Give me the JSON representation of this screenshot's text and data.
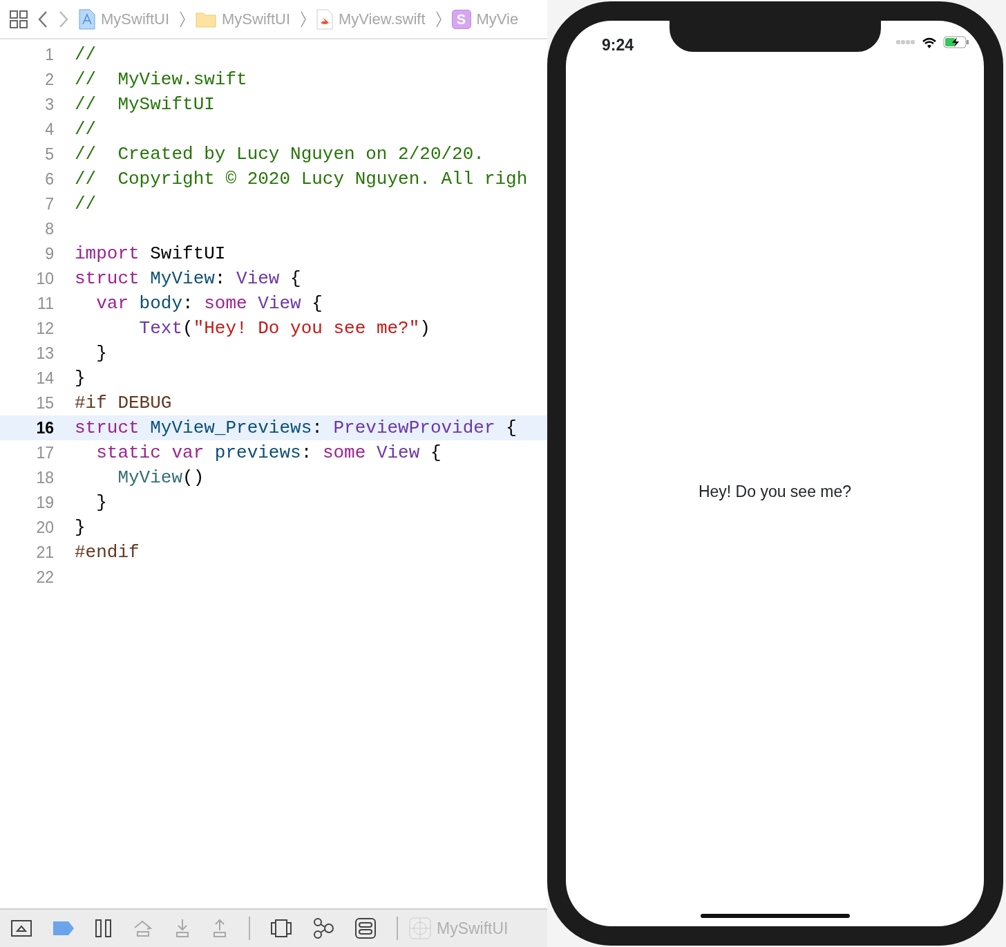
{
  "breadcrumb": [
    {
      "label": "MySwiftUI",
      "kind": "project"
    },
    {
      "label": "MySwiftUI",
      "kind": "folder"
    },
    {
      "label": "MyView.swift",
      "kind": "swift"
    },
    {
      "label": "MyVie",
      "kind": "struct",
      "badge": "S"
    }
  ],
  "code_lines": [
    {
      "number": "1",
      "current": false,
      "tokens": [
        {
          "text": "//",
          "kind": "comment"
        }
      ]
    },
    {
      "number": "2",
      "current": false,
      "tokens": [
        {
          "text": "//  MyView.swift",
          "kind": "comment"
        }
      ]
    },
    {
      "number": "3",
      "current": false,
      "tokens": [
        {
          "text": "//  MySwiftUI",
          "kind": "comment"
        }
      ]
    },
    {
      "number": "4",
      "current": false,
      "tokens": [
        {
          "text": "//",
          "kind": "comment"
        }
      ]
    },
    {
      "number": "5",
      "current": false,
      "tokens": [
        {
          "text": "//  Created by Lucy Nguyen on 2/20/20.",
          "kind": "comment"
        }
      ]
    },
    {
      "number": "6",
      "current": false,
      "tokens": [
        {
          "text": "//  Copyright © 2020 Lucy Nguyen. All righ",
          "kind": "comment"
        }
      ]
    },
    {
      "number": "7",
      "current": false,
      "tokens": [
        {
          "text": "//",
          "kind": "comment"
        }
      ]
    },
    {
      "number": "8",
      "current": false
    },
    {
      "number": "9",
      "current": false,
      "tokens": [
        {
          "text": "import",
          "kind": "keyword"
        },
        {
          "text": " SwiftUI",
          "kind": "plain"
        }
      ]
    },
    {
      "number": "10",
      "current": false,
      "tokens": [
        {
          "text": "struct",
          "kind": "keyword"
        },
        {
          "text": " MyView",
          "kind": "decl"
        },
        {
          "text": ": ",
          "kind": "plain"
        },
        {
          "text": "View",
          "kind": "type"
        },
        {
          "text": " {",
          "kind": "plain"
        }
      ]
    },
    {
      "number": "11",
      "current": false,
      "tokens": [
        {
          "text": "  var",
          "kind": "keyword"
        },
        {
          "text": " body",
          "kind": "decl"
        },
        {
          "text": ": ",
          "kind": "plain"
        },
        {
          "text": "some",
          "kind": "keyword"
        },
        {
          "text": " View",
          "kind": "type"
        },
        {
          "text": " {",
          "kind": "plain"
        }
      ]
    },
    {
      "number": "12",
      "current": false,
      "tokens": [
        {
          "text": "      Text",
          "kind": "type"
        },
        {
          "text": "(",
          "kind": "plain"
        },
        {
          "text": "\"Hey! Do you see me?\"",
          "kind": "string"
        },
        {
          "text": ")",
          "kind": "plain"
        }
      ]
    },
    {
      "number": "13",
      "current": false,
      "tokens": [
        {
          "text": "  }",
          "kind": "plain"
        }
      ]
    },
    {
      "number": "14",
      "current": false,
      "tokens": [
        {
          "text": "}",
          "kind": "plain"
        }
      ]
    },
    {
      "number": "15",
      "current": false,
      "tokens": [
        {
          "text": "#if DEBUG",
          "kind": "preproc"
        }
      ]
    },
    {
      "number": "16",
      "current": true,
      "tokens": [
        {
          "text": "struct",
          "kind": "keyword"
        },
        {
          "text": " MyView_Previews",
          "kind": "decl"
        },
        {
          "text": ": ",
          "kind": "plain"
        },
        {
          "text": "PreviewProvider",
          "kind": "type"
        },
        {
          "text": " {",
          "kind": "plain"
        }
      ]
    },
    {
      "number": "17",
      "current": false,
      "tokens": [
        {
          "text": "  static var",
          "kind": "keyword"
        },
        {
          "text": " previews",
          "kind": "decl"
        },
        {
          "text": ": ",
          "kind": "plain"
        },
        {
          "text": "some",
          "kind": "keyword"
        },
        {
          "text": " View",
          "kind": "type"
        },
        {
          "text": " {",
          "kind": "plain"
        }
      ]
    },
    {
      "number": "18",
      "current": false,
      "tokens": [
        {
          "text": "    MyView",
          "kind": "call"
        },
        {
          "text": "()",
          "kind": "plain"
        }
      ]
    },
    {
      "number": "19",
      "current": false,
      "tokens": [
        {
          "text": "  }",
          "kind": "plain"
        }
      ]
    },
    {
      "number": "20",
      "current": false,
      "tokens": [
        {
          "text": "}",
          "kind": "plain"
        }
      ]
    },
    {
      "number": "21",
      "current": false,
      "tokens": [
        {
          "text": "#endif",
          "kind": "preproc"
        }
      ]
    },
    {
      "number": "22",
      "current": false
    }
  ],
  "debug_bar": {
    "process": "MySwiftUI"
  },
  "preview": {
    "time": "9:24",
    "text": "Hey! Do you see me?"
  }
}
